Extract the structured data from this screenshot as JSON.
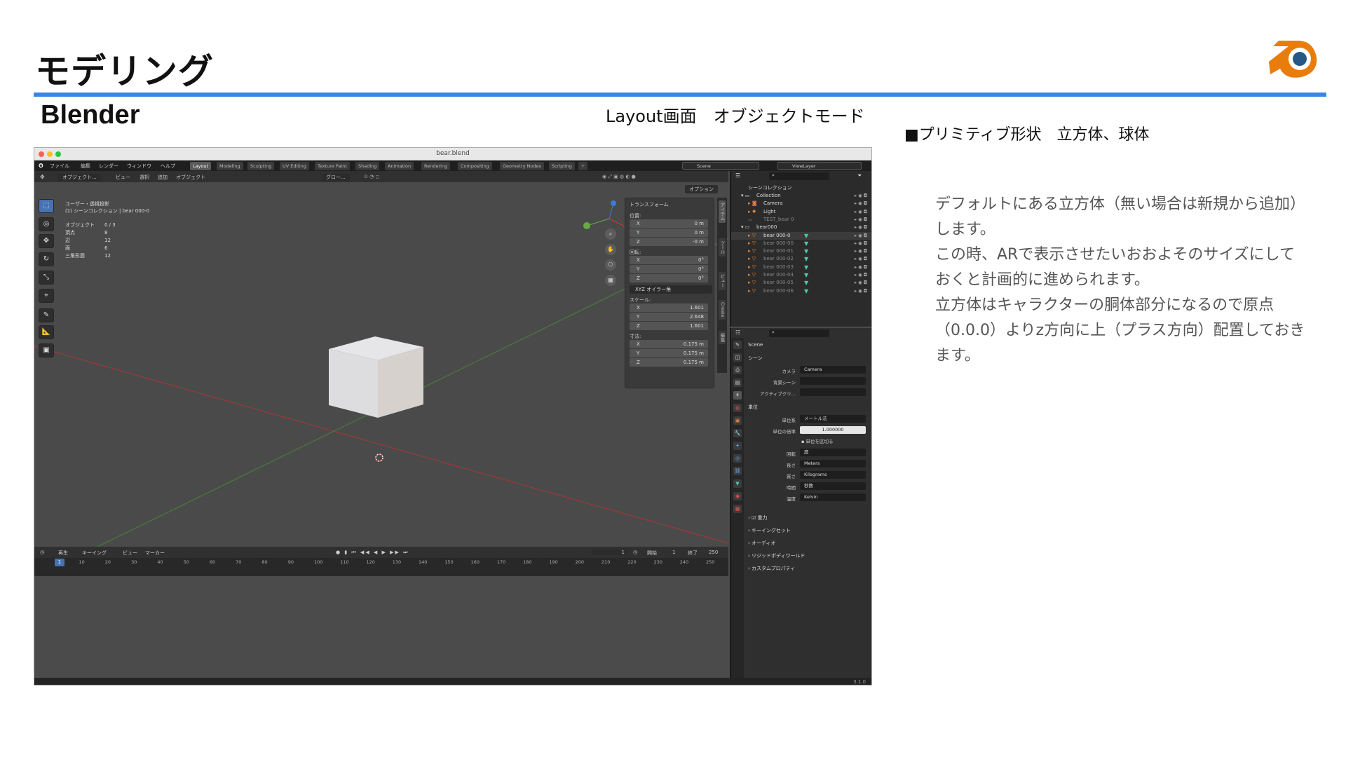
{
  "slide": {
    "title": "モデリング",
    "subtitle": "Blender",
    "layout_caption": "Layout画面　オブジェクトモード",
    "primitive_heading": "■プリミティブ形状　立方体、球体",
    "description_lines": [
      "デフォルトにある立方体（無い場合は新規から追加）",
      "します。",
      "この時、ARで表示させたいおおよそのサイズにして",
      "おくと計画的に進められます。",
      "立方体はキャラクターの胴体部分になるので原点",
      "（0.0.0）よりz方向に上（プラス方向）配置しておき",
      "ます。"
    ],
    "colors": {
      "accent_rule": "#3a86e0",
      "logo_orange": "#e87d0d",
      "logo_blue": "#265787"
    }
  },
  "window": {
    "title": "bear.blend"
  },
  "menu": [
    "ファイル",
    "編集",
    "レンダー",
    "ウィンドウ",
    "ヘルプ"
  ],
  "workspaces": [
    "Layout",
    "Modeling",
    "Sculpting",
    "UV Editing",
    "Texture Paint",
    "Shading",
    "Animation",
    "Rendering",
    "Compositing",
    "Geometry Nodes",
    "Scripting",
    "+"
  ],
  "active_workspace": "Layout",
  "scene_field": "Scene",
  "viewlayer_field": "ViewLayer",
  "viewport_header": {
    "mode": "オブジェクト...",
    "items": [
      "ビュー",
      "選択",
      "追加",
      "オブジェクト"
    ],
    "transform_orientation": "グロー...",
    "options": "オプション"
  },
  "viewport_info": {
    "line1": "ユーザー・透視投影",
    "line2": "(1) シーンコレクション | bear 000-0",
    "stats": [
      {
        "k": "オブジェクト",
        "v": "0 / 3"
      },
      {
        "k": "頂点",
        "v": "8"
      },
      {
        "k": "辺",
        "v": "12"
      },
      {
        "k": "面",
        "v": "6"
      },
      {
        "k": "三角形面",
        "v": "12"
      }
    ]
  },
  "tools": [
    "select-box",
    "cursor",
    "move",
    "rotate",
    "scale",
    "transform",
    "annotate",
    "measure",
    "add-cube"
  ],
  "npanel": {
    "heading": "トランスフォーム",
    "location_label": "位置:",
    "location": [
      {
        "ax": "X",
        "v": "0 m"
      },
      {
        "ax": "Y",
        "v": "0 m"
      },
      {
        "ax": "Z",
        "v": "-0 m"
      }
    ],
    "rotation_label": "回転:",
    "rotation": [
      {
        "ax": "X",
        "v": "0°"
      },
      {
        "ax": "Y",
        "v": "0°"
      },
      {
        "ax": "Z",
        "v": "0°"
      }
    ],
    "rotation_mode": "XYZ オイラー角",
    "scale_label": "スケール:",
    "scale": [
      {
        "ax": "X",
        "v": "1.601"
      },
      {
        "ax": "Y",
        "v": "2.648"
      },
      {
        "ax": "Z",
        "v": "1.601"
      }
    ],
    "dimensions_label": "寸法:",
    "dimensions": [
      {
        "ax": "X",
        "v": "0.175 m"
      },
      {
        "ax": "Y",
        "v": "0.175 m"
      },
      {
        "ax": "Z",
        "v": "0.175 m"
      }
    ]
  },
  "side_tabs": [
    "アイテム",
    "ツール",
    "ビュー",
    "Create",
    "編集"
  ],
  "timeline": {
    "playback": "再生",
    "keying": "キーイング",
    "view": "ビュー",
    "marker": "マーカー",
    "current_frame": "1",
    "start_label": "開始",
    "start": "1",
    "end_label": "終了",
    "end": "250",
    "ticks": [
      "1",
      "10",
      "20",
      "30",
      "40",
      "50",
      "60",
      "70",
      "80",
      "90",
      "100",
      "110",
      "120",
      "130",
      "140",
      "150",
      "160",
      "170",
      "180",
      "190",
      "200",
      "210",
      "220",
      "230",
      "240",
      "250"
    ]
  },
  "outliner": {
    "root": "シーンコレクション",
    "rows": [
      {
        "label": "Collection",
        "type": "collection"
      },
      {
        "label": "Camera",
        "type": "camera"
      },
      {
        "label": "Light",
        "type": "light"
      },
      {
        "label": "TEST_bear 0",
        "type": "dim"
      },
      {
        "label": "bear000",
        "type": "collection"
      },
      {
        "label": "bear 000-0",
        "type": "mesh-active"
      },
      {
        "label": "bear 000-00",
        "type": "mesh"
      },
      {
        "label": "bear 000-01",
        "type": "mesh"
      },
      {
        "label": "bear 000-02",
        "type": "mesh"
      },
      {
        "label": "bear 000-03",
        "type": "mesh"
      },
      {
        "label": "bear 000-04",
        "type": "mesh"
      },
      {
        "label": "bear 000-05",
        "type": "mesh"
      },
      {
        "label": "bear 000-06",
        "type": "mesh"
      }
    ]
  },
  "properties": {
    "scene_name": "Scene",
    "scene_section": "シーン",
    "camera_label": "カメラ",
    "camera_value": "Camera",
    "bg_scene_label": "背景シーン",
    "active_clip_label": "アクティブクリ...",
    "units_section": "単位",
    "unit_system_label": "単位系",
    "unit_system": "メートル法",
    "unit_scale_label": "単位の倍率",
    "unit_scale": "1.000000",
    "separate_units": "単位を区切る",
    "rotation_label": "回転",
    "rotation_value": "度",
    "length_label": "長さ",
    "length_value": "Meters",
    "mass_label": "質さ",
    "mass_value": "Kilograms",
    "time_label": "時間",
    "time_value": "秒数",
    "temp_label": "温度",
    "temp_value": "Kelvin",
    "collapsed": [
      "重力",
      "キーイングセット",
      "オーディオ",
      "リジッドボディワールド",
      "カスタムプロパティ"
    ]
  },
  "version": "3.1.0"
}
